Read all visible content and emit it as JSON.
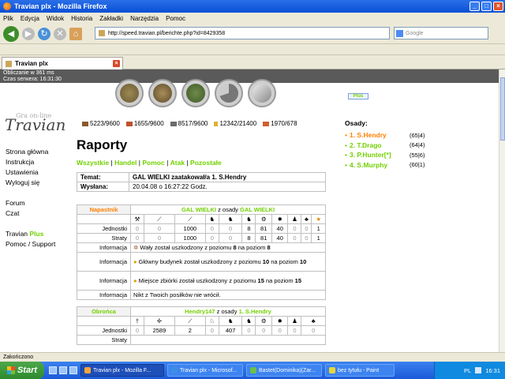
{
  "window": {
    "title": "Travian plx - Mozilla Firefox"
  },
  "menu": [
    "Plik",
    "Edycja",
    "Widok",
    "Historia",
    "Zakładki",
    "Narzędzia",
    "Pomoc"
  ],
  "nav": {
    "url": "http://speed.travian.pl/berichte.php?id=8429358",
    "search_placeholder": "Google"
  },
  "tab": {
    "label": "Travian plx"
  },
  "server": {
    "line1": "Obliczanie w 361 ms",
    "line2": "Czas serwera: 16:31:30"
  },
  "plus_button": "Plus",
  "logo": {
    "text": "Travian",
    "sub": "Gra on-line"
  },
  "resources": [
    "5223/9600",
    "1655/9600",
    "8517/9600",
    "12342/21400",
    "1970/678"
  ],
  "left_menu": {
    "group1": [
      "Strona główna",
      "Instrukcja",
      "Ustawienia",
      "Wyloguj się"
    ],
    "group2": [
      "Forum",
      "Czat"
    ],
    "travian": "Travian",
    "plus": "Plus",
    "support": "Pomoc / Support"
  },
  "page_title": "Raporty",
  "subnav": {
    "a": "Wszystkie",
    "b": "Handel",
    "c": "Pomoc",
    "d": "Atak",
    "e": "Pozostałe"
  },
  "report": {
    "subject_label": "Temat:",
    "subject": "GAL WIELKI zaatakował/a 1. S.Hendry",
    "sent_label": "Wysłana:",
    "sent": "20.04.08 o 16:27:22 Godz."
  },
  "attacker": {
    "role": "Napastnik",
    "player": "GAL WIELKI",
    "from": "z osady",
    "village": "GAL WIELKI",
    "units_label": "Jednostki",
    "losses_label": "Straty",
    "units": [
      "0",
      "0",
      "1000",
      "0",
      "0",
      "8",
      "81",
      "40",
      "0",
      "0",
      "1"
    ],
    "losses": [
      "0",
      "0",
      "1000",
      "0",
      "0",
      "8",
      "81",
      "40",
      "0",
      "0",
      "1"
    ],
    "info_label": "Informacja",
    "info": [
      {
        "a": "Wały został uszkodzony z poziomu ",
        "b": "8",
        "c": " na poziom ",
        "d": "8"
      },
      {
        "a": "Główny budynek został uszkodzony z poziomu ",
        "b": "10",
        "c": " na poziom ",
        "d": "10"
      },
      {
        "a": "Miejsce zbiórki został uszkodzony z poziomu ",
        "b": "15",
        "c": " na poziom ",
        "d": "15"
      },
      {
        "a": "Nikt z Twoich posiłków nie wrócił."
      }
    ]
  },
  "defender": {
    "role": "Obrońca",
    "player": "Hendry147",
    "from": "z osady",
    "village": "1. S.Hendry",
    "units_label": "Jednostki",
    "losses_label": "Straty",
    "units": [
      "0",
      "2589",
      "2",
      "0",
      "407",
      "0",
      "0",
      "0",
      "0",
      "0"
    ]
  },
  "villages": {
    "title": "Osady:",
    "list": [
      {
        "name": "1. S.Hendry",
        "coords": "(65|4)"
      },
      {
        "name": "2. T.Drago",
        "coords": "(64|4)"
      },
      {
        "name": "3. P.Hunter[*]",
        "coords": "(55|6)"
      },
      {
        "name": "4. S.Murphy",
        "coords": "(60|1)"
      }
    ]
  },
  "status": "Zakończono",
  "taskbar": {
    "start": "Start",
    "tasks": [
      "Travian plx - Mozilla F...",
      "Travian plx - Microsof...",
      "Bastet(Dominika)(Zar...",
      "bez tytułu - Paint"
    ],
    "lang": "PL",
    "clock": "16:31"
  }
}
